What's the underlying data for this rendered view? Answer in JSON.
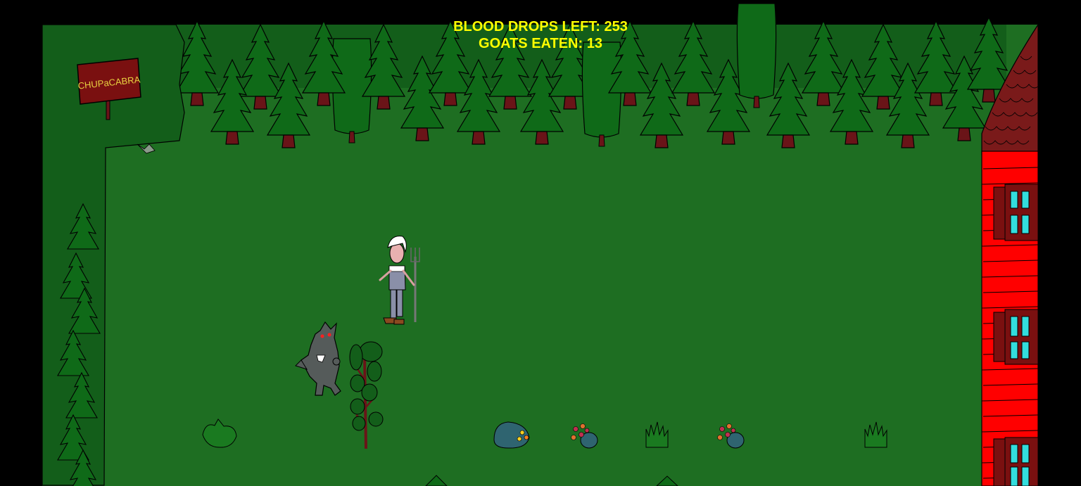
{
  "hud": {
    "blood_drops_label": "BLOOD DROPS LEFT:",
    "blood_drops_value": "253",
    "goats_eaten_label": "GOATS EATEN:",
    "goats_eaten_value": "13"
  },
  "sign": {
    "text": "CHUPaCABRA"
  },
  "colors": {
    "background": "#000000",
    "grass": "#1e6e22",
    "hedge": "#135e1a",
    "pine": "#0f6a18",
    "trunk": "#6a1418",
    "house_wall": "#ff0000",
    "house_roof": "#7a1a1a",
    "window_glass": "#33dddd",
    "hud_text": "#ffff00",
    "sign_board": "#7a1010",
    "sign_text": "#e8d040"
  },
  "entities": [
    {
      "type": "farmer",
      "icon": "farmer-with-pitchfork-icon"
    },
    {
      "type": "player",
      "icon": "chupacabra-icon"
    }
  ]
}
